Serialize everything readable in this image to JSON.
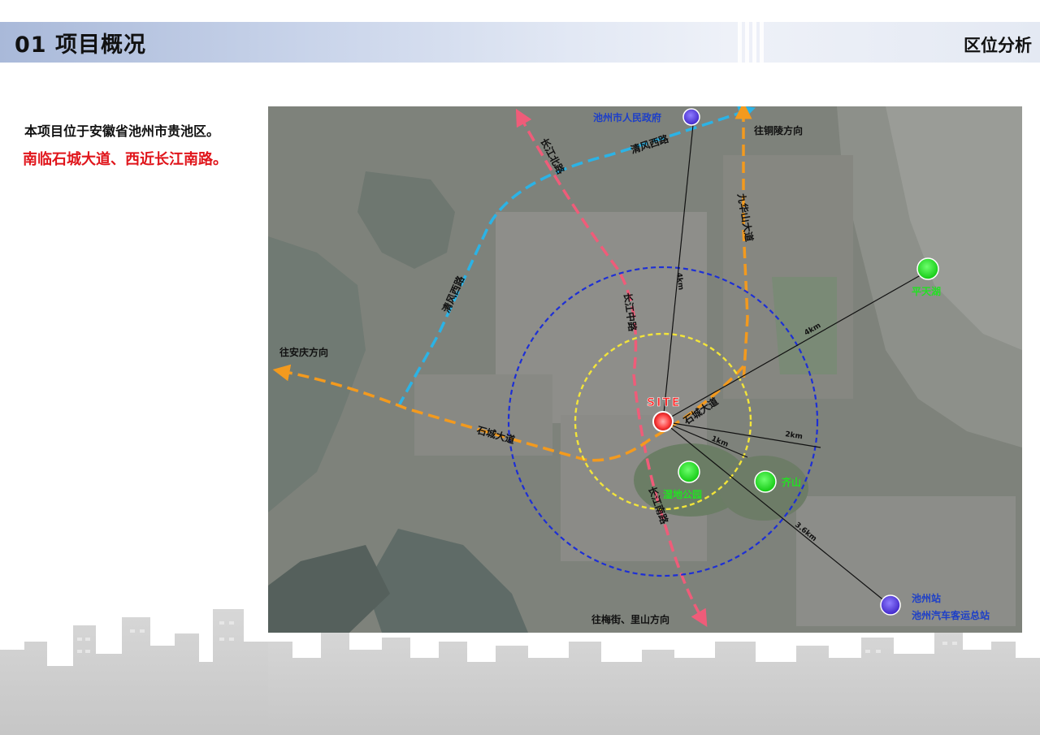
{
  "header": {
    "section_title": "01  项目概况",
    "section_subtitle": "区位分析"
  },
  "intro": {
    "line1": "本项目位于安徽省池州市贵池区。",
    "line2": "南临石城大道、西近长江南路。"
  },
  "colors": {
    "accent_red": "#e0151b",
    "ring_blue": "#1d2fd6",
    "ring_yellow": "#f2e43a",
    "road_cyan": "#2bb3e6",
    "road_pink": "#ef5c79",
    "road_orange": "#f39a1e",
    "poi_green": "#1bd61b",
    "poi_purple": "#5b3bd6"
  },
  "map": {
    "site_label": "SITE",
    "pois": {
      "government": "池州市人民政府",
      "pingtian_lake": "平天湖",
      "qi_mountain": "齐山",
      "wetland_park": "湿地公园",
      "station_1": "池州站",
      "station_2": "池州汽车客运总站"
    },
    "roads": {
      "qingfeng_west_top": "清风西路",
      "qingfeng_west_left": "清风西路",
      "changjiang_north": "长江北路",
      "changjiang_middle": "长江中路",
      "changjiang_south": "长江南路",
      "jiuhuashan": "九华山大道",
      "shicheng_west": "石城大道",
      "shicheng_east": "石城大道"
    },
    "directions": {
      "tongling": "往铜陵方向",
      "anqing": "往安庆方向",
      "meijie": "往梅街、里山方向"
    },
    "distances": {
      "gov": "4km",
      "lake": "4km",
      "ring_outer": "2km",
      "ring_inner": "1km",
      "station": "3.6km"
    }
  }
}
